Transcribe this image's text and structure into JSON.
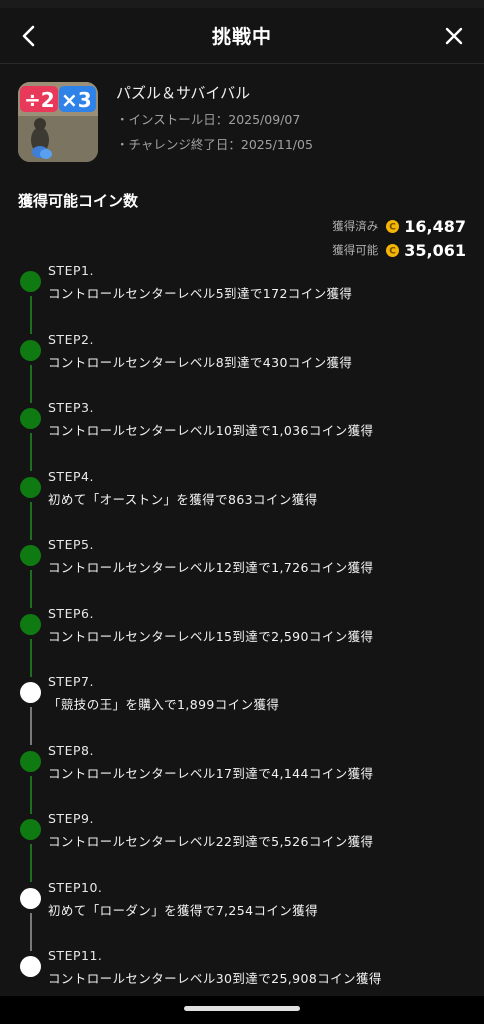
{
  "header": {
    "title": "挑戦中",
    "back_icon": "chevron-left-icon",
    "close_icon": "close-icon"
  },
  "app": {
    "name": "パズル＆サバイバル",
    "install": "・インストール日：2025/09/07",
    "end": "・チャレンジ終了日：2025/11/05",
    "icon_text_left": "÷2",
    "icon_text_right": "×3"
  },
  "coins": {
    "section_title": "獲得可能コイン数",
    "earned_label": "獲得済み",
    "earned_value": "16,487",
    "available_label": "獲得可能",
    "available_value": "35,061",
    "coin_color": "#f2b705"
  },
  "steps": [
    {
      "num": "STEP1.",
      "desc": "コントロールセンターレベル5到達で172コイン獲得",
      "done": true
    },
    {
      "num": "STEP2.",
      "desc": "コントロールセンターレベル8到達で430コイン獲得",
      "done": true
    },
    {
      "num": "STEP3.",
      "desc": "コントロールセンターレベル10到達で1,036コイン獲得",
      "done": true
    },
    {
      "num": "STEP4.",
      "desc": "初めて「オーストン」を獲得で863コイン獲得",
      "done": true
    },
    {
      "num": "STEP5.",
      "desc": "コントロールセンターレベル12到達で1,726コイン獲得",
      "done": true
    },
    {
      "num": "STEP6.",
      "desc": "コントロールセンターレベル15到達で2,590コイン獲得",
      "done": true
    },
    {
      "num": "STEP7.",
      "desc": "「競技の王」を購入で1,899コイン獲得",
      "done": false
    },
    {
      "num": "STEP8.",
      "desc": "コントロールセンターレベル17到達で4,144コイン獲得",
      "done": true
    },
    {
      "num": "STEP9.",
      "desc": "コントロールセンターレベル22到達で5,526コイン獲得",
      "done": true
    },
    {
      "num": "STEP10.",
      "desc": "初めて「ローダン」を獲得で7,254コイン獲得",
      "done": false
    },
    {
      "num": "STEP11.",
      "desc": "コントロールセンターレベル30到達で25,908コイン獲得",
      "done": false
    }
  ],
  "colors": {
    "done": "#0f7a12",
    "todo": "#ffffff",
    "background": "#141414"
  }
}
